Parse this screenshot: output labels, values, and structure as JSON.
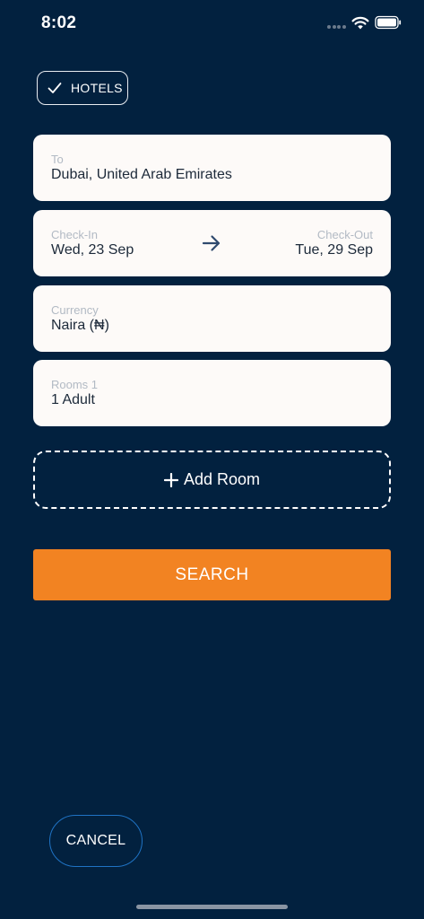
{
  "status_bar": {
    "time": "8:02"
  },
  "filter": {
    "hotels_label": "HOTELS",
    "selected": true
  },
  "destination": {
    "label": "To",
    "value": "Dubai, United Arab Emirates"
  },
  "dates": {
    "checkin_label": "Check-In",
    "checkin_value": "Wed, 23 Sep",
    "checkout_label": "Check-Out",
    "checkout_value": "Tue, 29 Sep"
  },
  "currency": {
    "label": "Currency",
    "value": "Naira (₦)"
  },
  "rooms": {
    "label": "Rooms 1",
    "value": "1 Adult"
  },
  "actions": {
    "add_room_label": "Add Room",
    "search_label": "SEARCH",
    "cancel_label": "CANCEL"
  },
  "colors": {
    "background": "#02213f",
    "accent": "#f28322",
    "card": "#fdfaf8",
    "cancel_border": "#1f73c4"
  },
  "icons": {
    "check": "check-icon",
    "arrow": "arrow-right-icon",
    "plus": "plus-icon",
    "wifi": "wifi-icon",
    "battery": "battery-icon"
  }
}
